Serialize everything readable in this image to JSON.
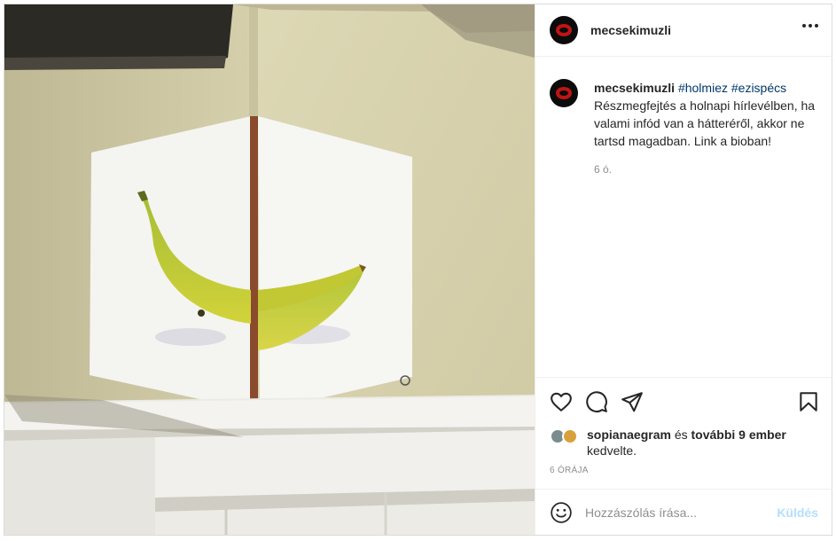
{
  "post": {
    "username": "mecsekimuzli",
    "caption": {
      "author": "mecsekimuzli",
      "hashtags": [
        "#holmiez",
        "#ezispécs"
      ],
      "text": "Részmegfejtés a holnapi hírlevélben, ha valami infód van a hátteréről, akkor ne tartsd magadban. Link a bioban!",
      "time": "6 ó."
    },
    "likes": {
      "user": "sopianaegram",
      "connector": "és",
      "others": "további 9 ember",
      "suffix": "kedvelte."
    },
    "timestamp": "6 ÓRÁJA",
    "comment": {
      "placeholder": "Hozzászólás írása...",
      "send_label": "Küldés"
    }
  },
  "icons": [
    "more-icon",
    "heart-icon",
    "comment-icon",
    "share-icon",
    "bookmark-icon",
    "emoji-icon"
  ],
  "colors": {
    "hashtag": "#00376b",
    "send_disabled": "#b2dffc",
    "muted": "#8e8e8e"
  }
}
